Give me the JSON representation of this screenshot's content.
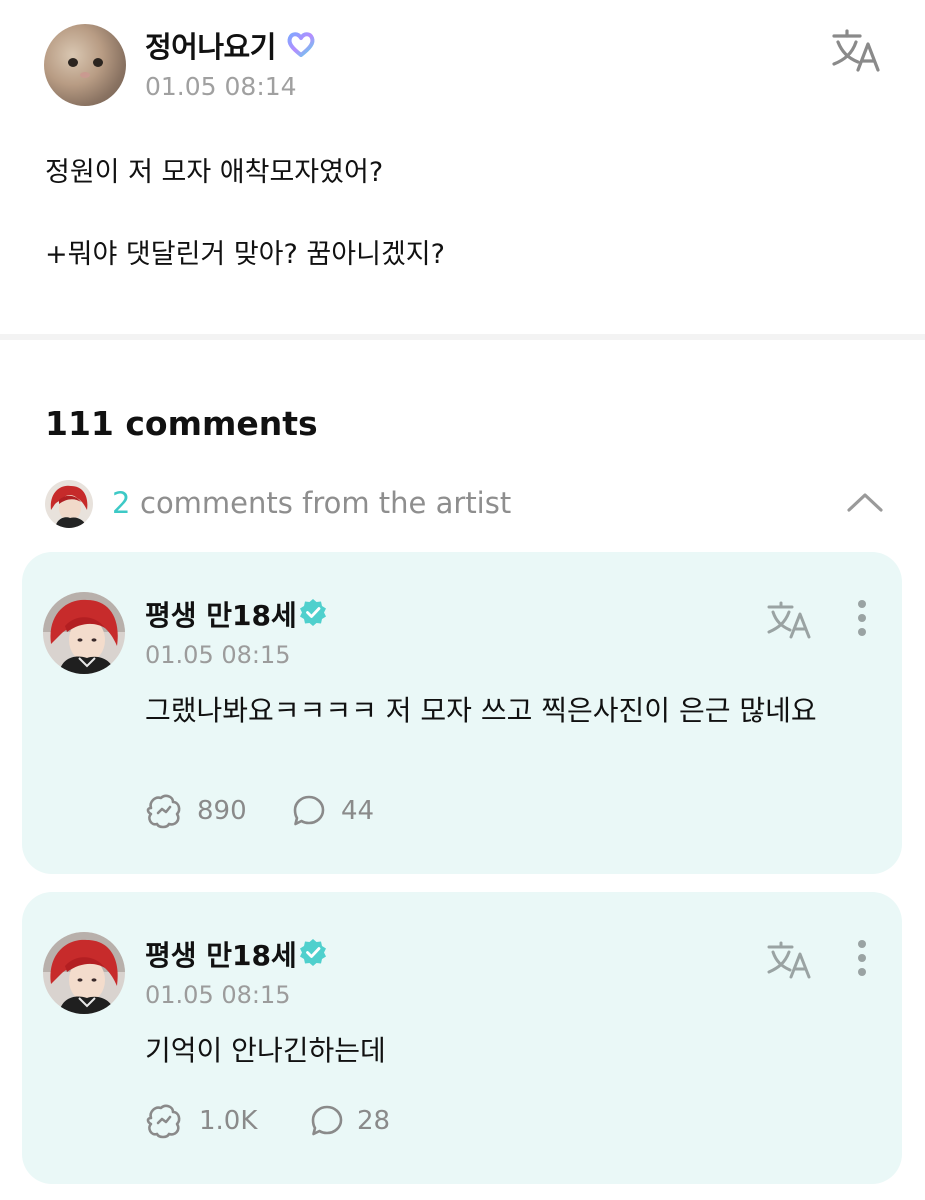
{
  "post": {
    "author": "정어나요기",
    "time": "01.05 08:14",
    "lines": [
      "정원이 저 모자 애착모자였어?",
      "+뭐야 댓달린거 맞아? 꿈아니겠지?"
    ]
  },
  "comments_header": {
    "count_label": "111 comments",
    "artist_count": "2",
    "artist_text": "comments from the artist"
  },
  "comments": [
    {
      "author": "평생 만18세",
      "time": "01.05 08:15",
      "text": "그랬나봐요ㅋㅋㅋㅋ 저 모자 쓰고 찍은사진이 은근 많네요",
      "likes": "890",
      "replies": "44"
    },
    {
      "author": "평생 만18세",
      "time": "01.05 08:15",
      "text": "기억이 안나긴하는데",
      "likes": "1.0K",
      "replies": "28"
    }
  ],
  "colors": {
    "accent": "#3dc9c6",
    "card_bg": "#eaf8f7",
    "muted": "#9c9c9c"
  },
  "icons": {
    "translate": "translate-icon",
    "verified": "verified-badge-icon",
    "fan_badge": "heart-badge-icon",
    "like": "like-icon",
    "reply": "reply-icon",
    "more": "more-vertical-icon",
    "collapse": "chevron-up-icon"
  }
}
